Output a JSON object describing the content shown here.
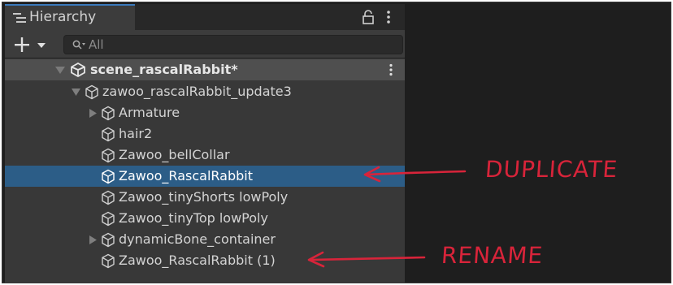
{
  "hierarchy_panel": {
    "tab_title": "Hierarchy",
    "search": {
      "value": "",
      "placeholder": "All"
    },
    "scene": {
      "name": "scene_rascalRabbit*"
    },
    "items": [
      {
        "label": "zawoo_rascalRabbit_update3",
        "depth": 1,
        "expanded": true,
        "selected": false
      },
      {
        "label": "Armature",
        "depth": 2,
        "has_children": true,
        "selected": false
      },
      {
        "label": "hair2",
        "depth": 2,
        "selected": false
      },
      {
        "label": "Zawoo_bellCollar",
        "depth": 2,
        "selected": false
      },
      {
        "label": "Zawoo_RascalRabbit",
        "depth": 2,
        "selected": true
      },
      {
        "label": "Zawoo_tinyShorts lowPoly",
        "depth": 2,
        "selected": false
      },
      {
        "label": "Zawoo_tinyTop lowPoly",
        "depth": 2,
        "selected": false
      },
      {
        "label": "dynamicBone_container",
        "depth": 2,
        "has_children": true,
        "selected": false
      },
      {
        "label": "Zawoo_RascalRabbit (1)",
        "depth": 2,
        "selected": false
      }
    ]
  },
  "annotations": {
    "duplicate": "DUPLICATE",
    "rename": "RENAME"
  },
  "colors": {
    "selection": "#2c5d87",
    "panel_background": "#383838",
    "annotation_red": "#d8243a"
  }
}
